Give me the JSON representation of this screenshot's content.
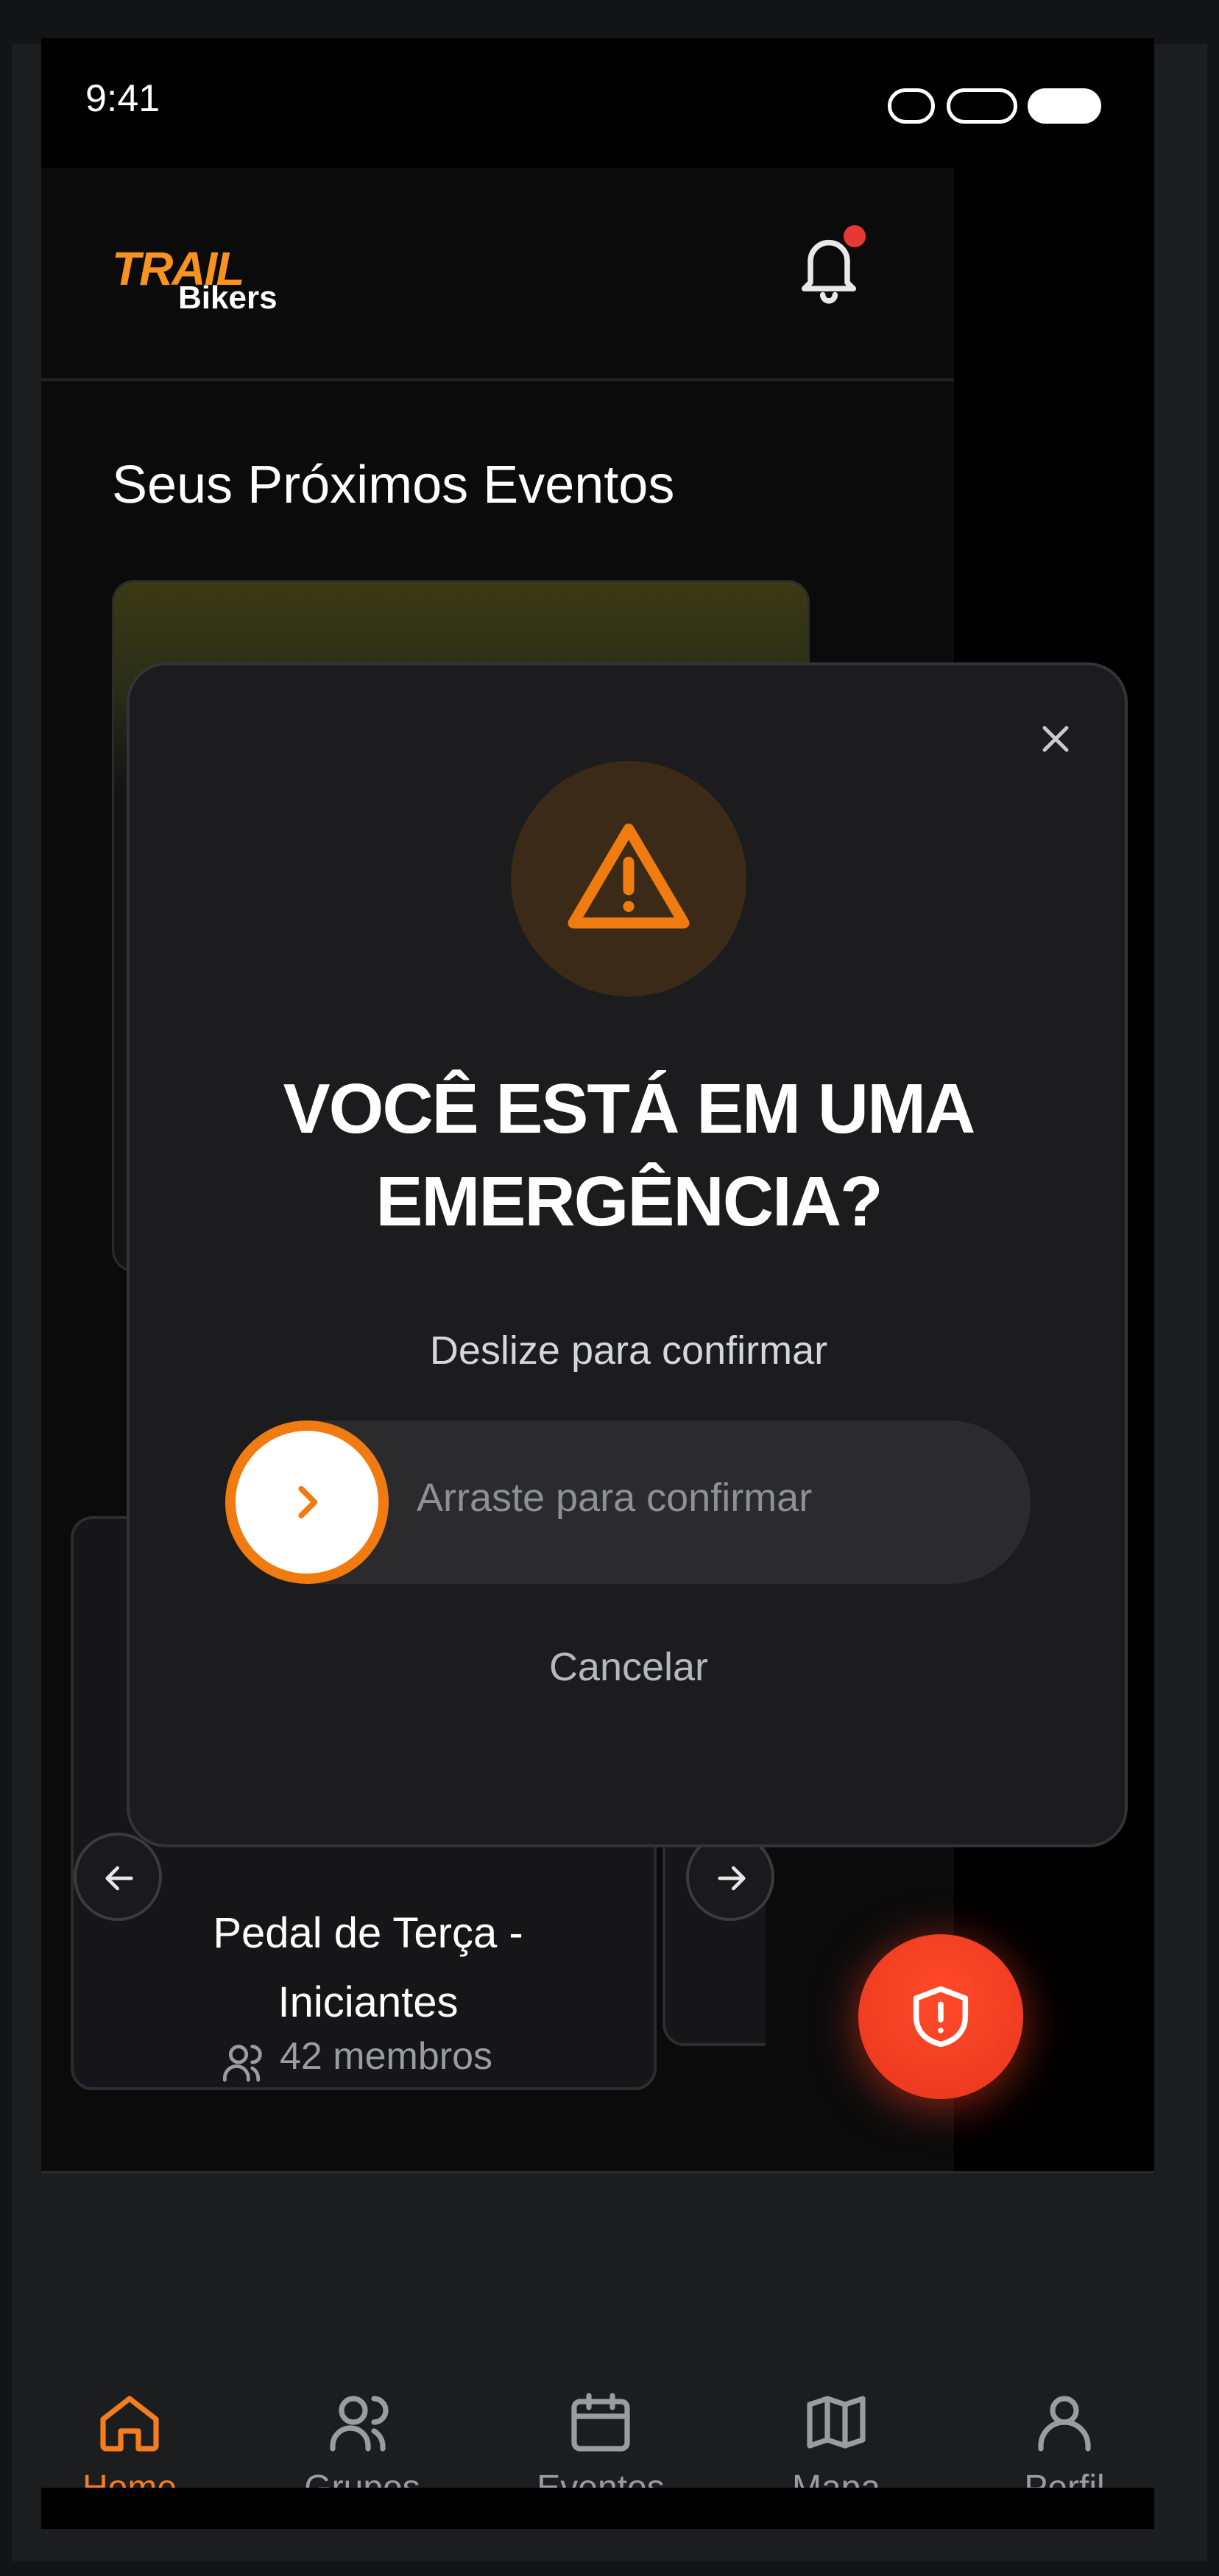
{
  "status_bar": {
    "time": "9:41"
  },
  "header": {
    "logo_line1": "TRAIL",
    "logo_line2": "Bikers",
    "notification_dot": true
  },
  "main": {
    "section_title": "Seus Próximos Eventos",
    "group_card": {
      "name_line1": "Pedal de Terça -",
      "name_line2": "Iniciantes",
      "members": "42 membros"
    }
  },
  "bottom_nav": {
    "items": [
      {
        "label": "Home",
        "icon": "home-icon",
        "active": true
      },
      {
        "label": "Grupos",
        "icon": "users-icon",
        "active": false
      },
      {
        "label": "Eventos",
        "icon": "calendar-icon",
        "active": false
      },
      {
        "label": "Mapa",
        "icon": "map-icon",
        "active": false
      },
      {
        "label": "Perfil",
        "icon": "user-icon",
        "active": false
      }
    ]
  },
  "modal": {
    "title_line1": "VOCÊ ESTÁ EM UMA",
    "title_line2": "EMERGÊNCIA?",
    "subtitle": "Deslize para confirmar",
    "slider_placeholder": "Arraste para confirmar",
    "cancel_label": "Cancelar"
  },
  "colors": {
    "accent": "#f57c1f",
    "sos": "#e8361c",
    "modal_bg": "#1c1c1e"
  }
}
